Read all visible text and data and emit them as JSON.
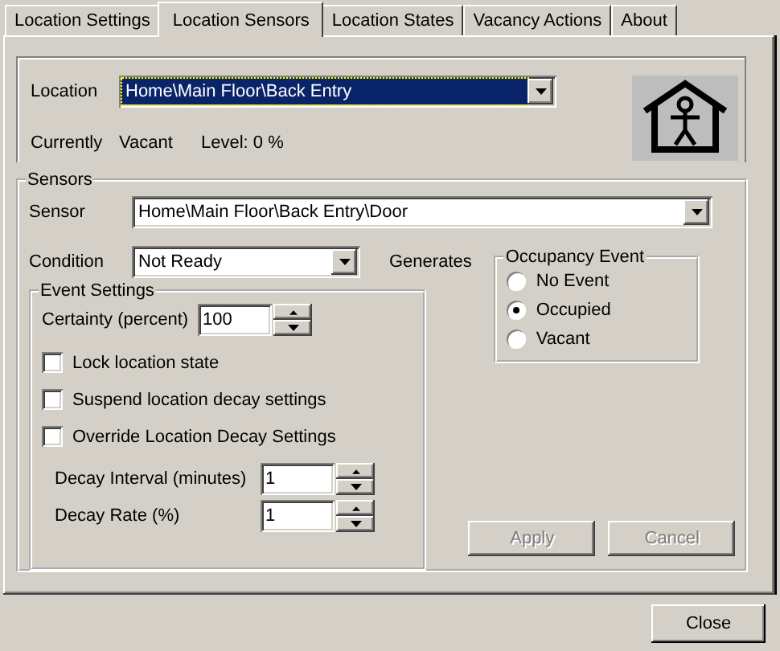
{
  "tabs": [
    {
      "label": "Location Settings",
      "selected": false
    },
    {
      "label": "Location Sensors",
      "selected": true
    },
    {
      "label": "Location States",
      "selected": false
    },
    {
      "label": "Vacancy Actions",
      "selected": false
    },
    {
      "label": "About",
      "selected": false
    }
  ],
  "location": {
    "label": "Location",
    "value": "Home\\Main Floor\\Back Entry",
    "focused": true
  },
  "status": {
    "label": "Currently",
    "value": "Vacant",
    "level_text": "Level: 0 %"
  },
  "sensors": {
    "title": "Sensors",
    "sensor": {
      "label": "Sensor",
      "value": "Home\\Main Floor\\Back Entry\\Door"
    },
    "condition": {
      "label": "Condition",
      "value": "Not Ready"
    },
    "generates": "Generates",
    "occupancy_event": {
      "title": "Occupancy Event",
      "options": [
        {
          "label": "No Event",
          "selected": false
        },
        {
          "label": "Occupied",
          "selected": true
        },
        {
          "label": "Vacant",
          "selected": false
        }
      ]
    },
    "event_settings": {
      "title": "Event Settings",
      "certainty": {
        "label": "Certainty (percent)",
        "value": "100"
      },
      "checkboxes": [
        {
          "label": "Lock location state",
          "checked": false
        },
        {
          "label": "Suspend location decay settings",
          "checked": false
        },
        {
          "label": "Override Location Decay Settings",
          "checked": false
        }
      ],
      "decay_interval": {
        "label": "Decay Interval (minutes)",
        "value": "1"
      },
      "decay_rate": {
        "label": "Decay Rate (%)",
        "value": "1"
      }
    },
    "buttons": [
      {
        "label": "Apply",
        "disabled": true
      },
      {
        "label": "Cancel",
        "disabled": true
      }
    ]
  },
  "close_button": "Close"
}
